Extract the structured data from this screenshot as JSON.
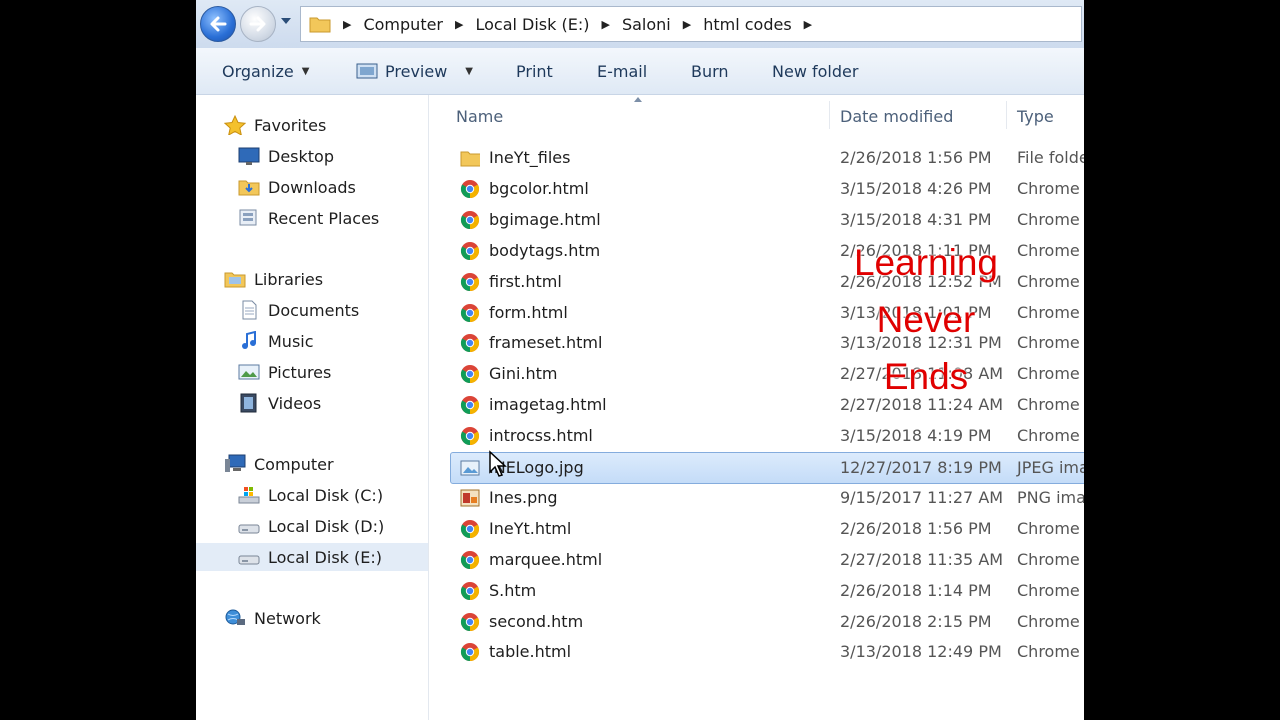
{
  "breadcrumb": [
    "Computer",
    "Local Disk (E:)",
    "Saloni",
    "html codes"
  ],
  "toolbar": {
    "organize": "Organize",
    "preview": "Preview",
    "print": "Print",
    "email": "E-mail",
    "burn": "Burn",
    "new_folder": "New folder"
  },
  "nav": {
    "favorites": "Favorites",
    "desktop": "Desktop",
    "downloads": "Downloads",
    "recent": "Recent Places",
    "libraries": "Libraries",
    "documents": "Documents",
    "music": "Music",
    "pictures": "Pictures",
    "videos": "Videos",
    "computer": "Computer",
    "disk_c": "Local Disk (C:)",
    "disk_d": "Local Disk (D:)",
    "disk_e": "Local Disk (E:)",
    "network": "Network"
  },
  "columns": {
    "name": "Name",
    "date": "Date modified",
    "type": "Type"
  },
  "files": [
    {
      "name": "IneYt_files",
      "date": "2/26/2018 1:56 PM",
      "type": "File folde",
      "icon": "folder-icon"
    },
    {
      "name": "bgcolor.html",
      "date": "3/15/2018 4:26 PM",
      "type": "Chrome",
      "icon": "chrome-icon"
    },
    {
      "name": "bgimage.html",
      "date": "3/15/2018 4:31 PM",
      "type": "Chrome",
      "icon": "chrome-icon"
    },
    {
      "name": "bodytags.htm",
      "date": "2/26/2018 1:11 PM",
      "type": "Chrome",
      "icon": "chrome-icon"
    },
    {
      "name": "first.html",
      "date": "2/26/2018 12:52 PM",
      "type": "Chrome",
      "icon": "chrome-icon"
    },
    {
      "name": "form.html",
      "date": "3/13/2018 1:01 PM",
      "type": "Chrome",
      "icon": "chrome-icon"
    },
    {
      "name": "frameset.html",
      "date": "3/13/2018 12:31 PM",
      "type": "Chrome",
      "icon": "chrome-icon"
    },
    {
      "name": "Gini.htm",
      "date": "2/27/2018 11:08 AM",
      "type": "Chrome",
      "icon": "chrome-icon"
    },
    {
      "name": "imagetag.html",
      "date": "2/27/2018 11:24 AM",
      "type": "Chrome",
      "icon": "chrome-icon"
    },
    {
      "name": "introcss.html",
      "date": "3/15/2018 4:19 PM",
      "type": "Chrome",
      "icon": "chrome-icon"
    },
    {
      "name": "INELogo.jpg",
      "date": "12/27/2017 8:19 PM",
      "type": "JPEG ima",
      "icon": "image-icon",
      "selected": true
    },
    {
      "name": "Ines.png",
      "date": "9/15/2017 11:27 AM",
      "type": "PNG ima",
      "icon": "png-icon"
    },
    {
      "name": "IneYt.html",
      "date": "2/26/2018 1:56 PM",
      "type": "Chrome",
      "icon": "chrome-icon"
    },
    {
      "name": "marquee.html",
      "date": "2/27/2018 11:35 AM",
      "type": "Chrome",
      "icon": "chrome-icon"
    },
    {
      "name": "S.htm",
      "date": "2/26/2018 1:14 PM",
      "type": "Chrome",
      "icon": "chrome-icon"
    },
    {
      "name": "second.htm",
      "date": "2/26/2018 2:15 PM",
      "type": "Chrome",
      "icon": "chrome-icon"
    },
    {
      "name": "table.html",
      "date": "3/13/2018 12:49 PM",
      "type": "Chrome",
      "icon": "chrome-icon"
    }
  ],
  "overlay": [
    "Learning",
    "Never",
    "Ends"
  ]
}
